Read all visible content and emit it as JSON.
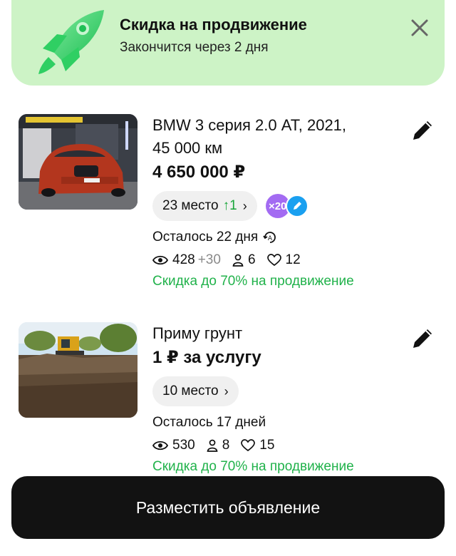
{
  "promo_banner": {
    "title": "Скидка на продвижение",
    "subtitle": "Закончится через 2 дня",
    "icon": "rocket-icon",
    "background": "#cdf3c6"
  },
  "listings": [
    {
      "title_line1": "BMW 3 серия 2.0 AT, 2021,",
      "title_line2": "45 000 км",
      "price": "4 650 000 ₽",
      "rank": "23 место",
      "rank_change": "↑1",
      "boost_badge": "×20",
      "remaining": "Осталось 22 дня",
      "views": "428",
      "views_delta": "+30",
      "contacts": "6",
      "favorites": "12",
      "promo_link": "Скидка до 70% на продвижение"
    },
    {
      "title_line1": "Приму грунт",
      "price": "1 ₽ за услугу",
      "rank": "10 место",
      "remaining": "Осталось 17 дней",
      "views": "530",
      "contacts": "8",
      "favorites": "15",
      "promo_link": "Скидка до 70% на продвижение"
    }
  ],
  "post_button": {
    "label": "Разместить объявление"
  },
  "colors": {
    "accent_green": "#21b24b",
    "button_dark": "#121212",
    "badge_purple": "#a36bf2",
    "badge_blue": "#1aa0f0"
  }
}
